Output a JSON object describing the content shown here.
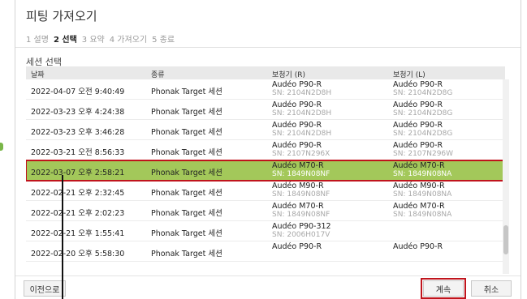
{
  "dialog": {
    "title": "피팅 가져오기",
    "steps": [
      "1 설명",
      "2 선택",
      "3 요약",
      "4 가져오기",
      "5 종료"
    ],
    "section_label": "세션 선택"
  },
  "table": {
    "headers": [
      "날짜",
      "종류",
      "보청기 (R)",
      "보청기 (L)"
    ],
    "rows": [
      {
        "date": "2022-04-07 오전 9:40:49",
        "type": "Phonak Target 세션",
        "r_model": "Audéo P90-R",
        "r_sn": "SN: 2104N2D8H",
        "l_model": "Audéo P90-R",
        "l_sn": "SN: 2104N2D8G"
      },
      {
        "date": "2022-03-23 오후 4:24:38",
        "type": "Phonak Target 세션",
        "r_model": "Audéo P90-R",
        "r_sn": "SN: 2104N2D8H",
        "l_model": "Audéo P90-R",
        "l_sn": "SN: 2104N2D8G"
      },
      {
        "date": "2022-03-23 오후 3:46:28",
        "type": "Phonak Target 세션",
        "r_model": "Audéo P90-R",
        "r_sn": "SN: 2104N2D8H",
        "l_model": "Audéo P90-R",
        "l_sn": "SN: 2104N2D8G"
      },
      {
        "date": "2022-03-21 오전 8:56:33",
        "type": "Phonak Target 세션",
        "r_model": "Audéo P90-R",
        "r_sn": "SN: 2107N296X",
        "l_model": "Audéo P90-R",
        "l_sn": "SN: 2107N296W"
      },
      {
        "date": "2022-03-07 오후 2:58:21",
        "type": "Phonak Target 세션",
        "r_model": "Audéo M70-R",
        "r_sn": "SN: 1849N08NF",
        "l_model": "Audéo M70-R",
        "l_sn": "SN: 1849N08NA"
      },
      {
        "date": "2022-02-21 오후 2:32:45",
        "type": "Phonak Target 세션",
        "r_model": "Audéo M90-R",
        "r_sn": "SN: 1849N08NF",
        "l_model": "Audéo M90-R",
        "l_sn": "SN: 1849N08NA"
      },
      {
        "date": "2022-02-21 오후 2:02:23",
        "type": "Phonak Target 세션",
        "r_model": "Audéo M70-R",
        "r_sn": "SN: 1849N08NF",
        "l_model": "Audéo M70-R",
        "l_sn": "SN: 1849N08NA"
      },
      {
        "date": "2022-02-21 오후 1:55:41",
        "type": "Phonak Target 세션",
        "r_model": "Audéo P90-312",
        "r_sn": "SN: 2006H017V",
        "l_model": "",
        "l_sn": ""
      },
      {
        "date": "2022-02-20 오후 5:58:30",
        "type": "Phonak Target 세션",
        "r_model": "Audéo P90-R",
        "r_sn": "",
        "l_model": "Audéo P90-R",
        "l_sn": ""
      }
    ],
    "selected_index": 4
  },
  "footer": {
    "prev_label": "이전으로",
    "next_label": "계속",
    "cancel_label": "취소"
  },
  "colors": {
    "selected_row": "#a3c85a",
    "highlight_outline": "#c0141c"
  }
}
